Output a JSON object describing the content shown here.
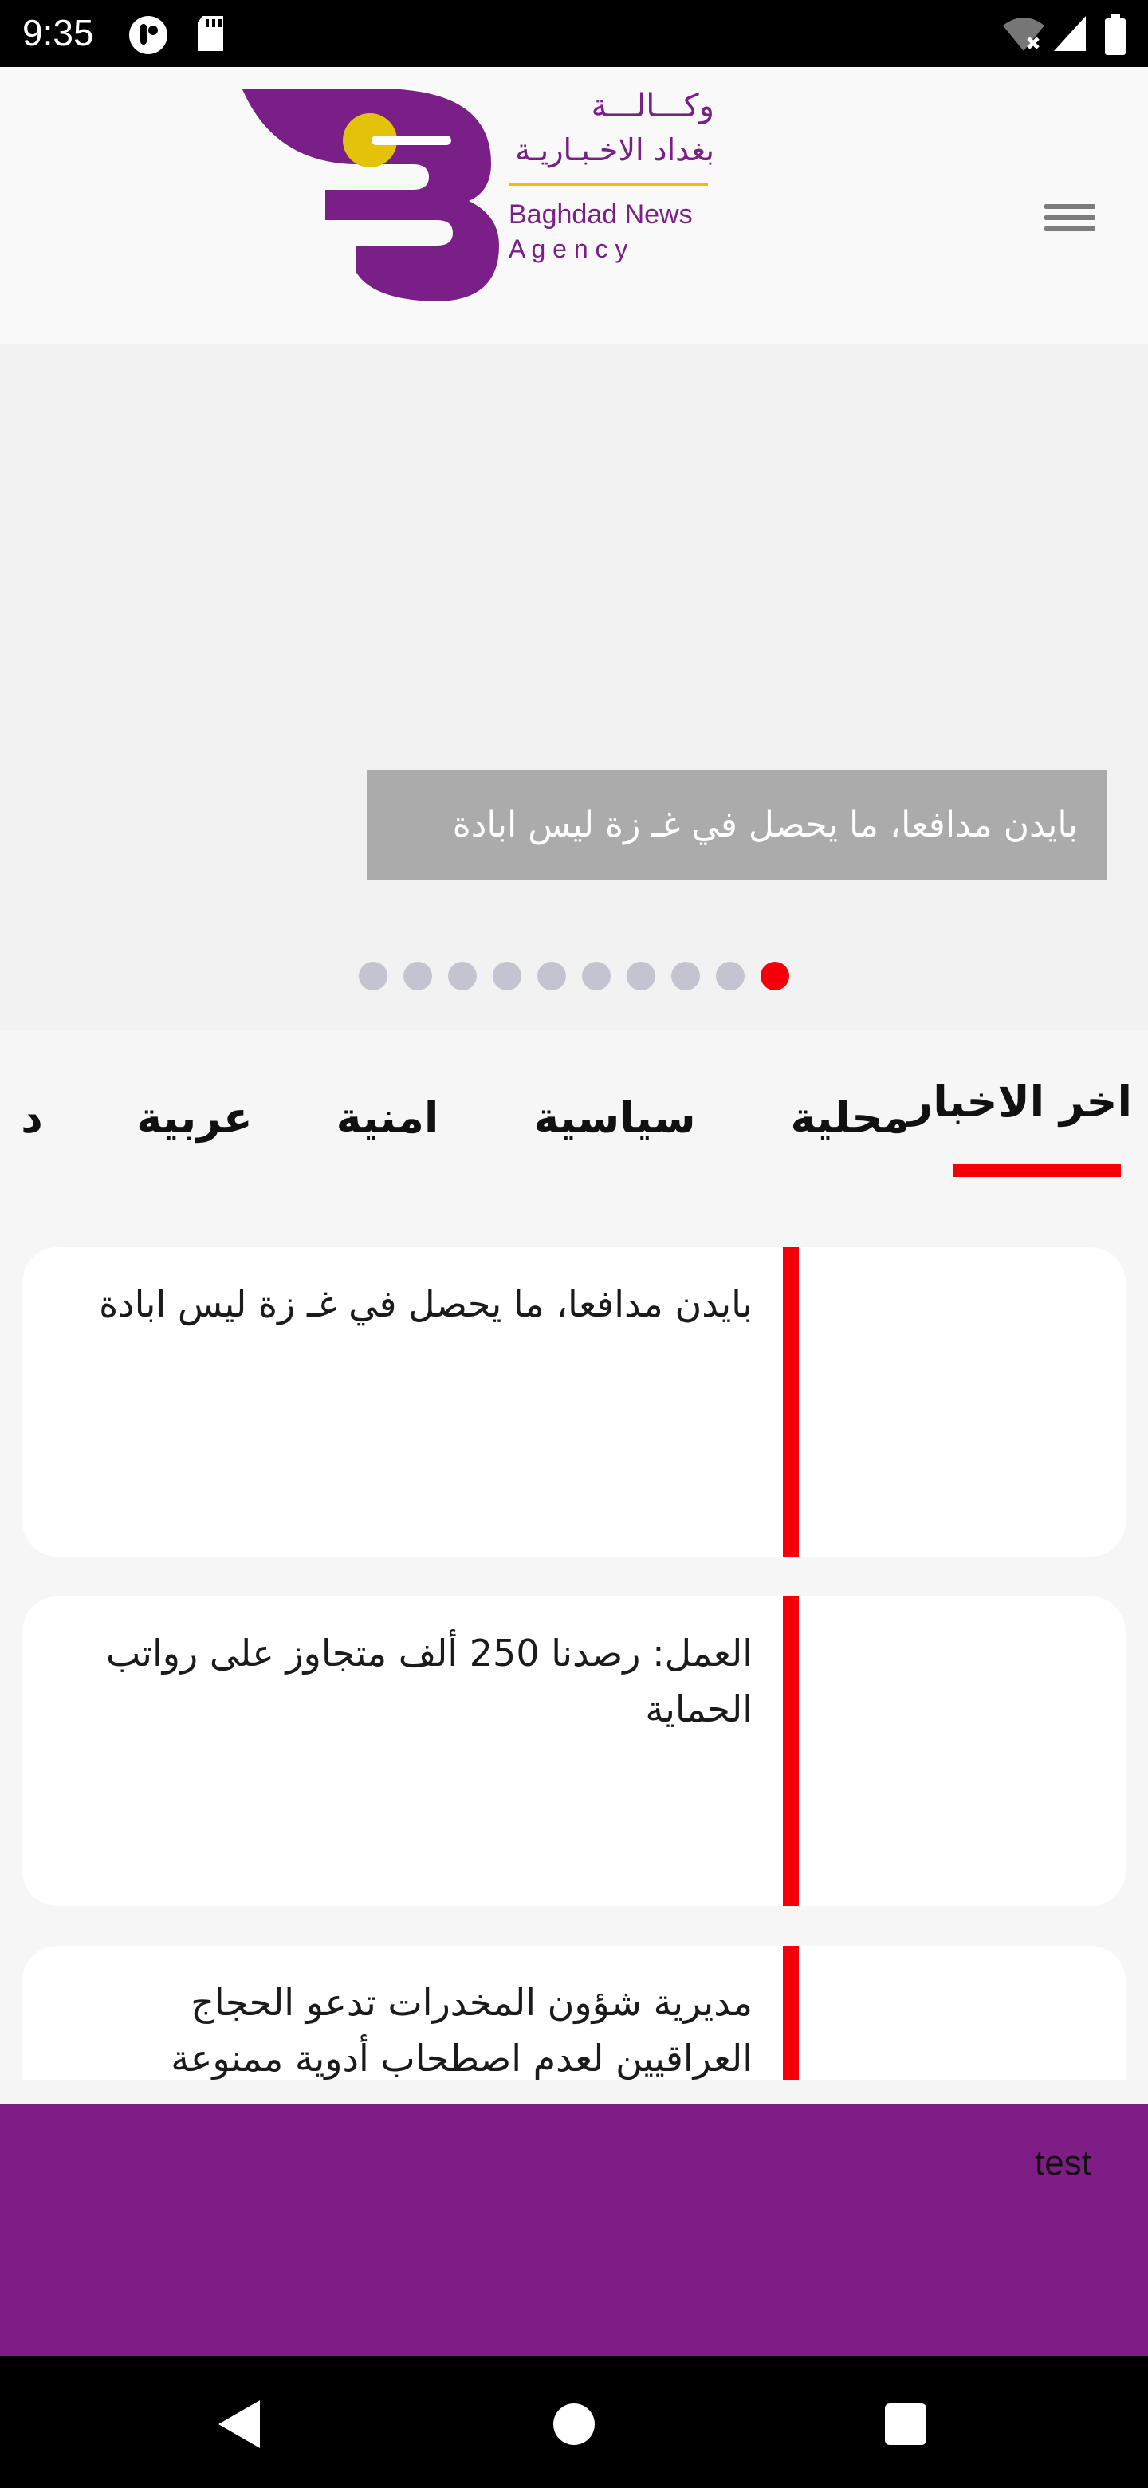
{
  "status_bar": {
    "time": "9:35",
    "left_icons": [
      "app-notification-icon",
      "sd-card-icon"
    ],
    "right_icons": [
      "wifi-off-icon",
      "cell-signal-icon",
      "battery-icon"
    ]
  },
  "header": {
    "logo_ar_line1": "وكـــالـــة",
    "logo_ar_line2": "بغداد الاخـبـاريـة",
    "logo_en_line1": "Baghdad News",
    "logo_en_line2": "A g e n c y",
    "menu_icon": "hamburger-menu-icon",
    "brand_purple": "#7a1f87",
    "brand_yellow": "#e2c30a"
  },
  "slider": {
    "caption": "بايدن مدافعا، ما يحصل في غـ زة ليس ابادة",
    "dot_count": 10,
    "active_dot_from_right": 1,
    "active_color": "#f3000b",
    "inactive_color": "#c3c4d0"
  },
  "tabs": {
    "items": [
      {
        "label": "اخر الاخبار",
        "active": true
      },
      {
        "label": "محلية",
        "active": false
      },
      {
        "label": "سياسية",
        "active": false
      },
      {
        "label": "امنية",
        "active": false
      },
      {
        "label": "عربية",
        "active": false
      },
      {
        "label": "د",
        "active": false
      }
    ]
  },
  "news": {
    "items": [
      {
        "title": "بايدن مدافعا، ما يحصل في غـ زة ليس ابادة"
      },
      {
        "title": "العمل: رصدنا 250 ألف متجاوز على رواتب الحماية"
      },
      {
        "title": "مديرية شؤون المخدرات تدعو الحجاج العراقيين لعدم اصطحاب أدوية ممنوعة"
      }
    ]
  },
  "footer": {
    "text": "test",
    "background": "#7f1d87"
  },
  "nav_bar": {
    "buttons": [
      "back-icon",
      "home-icon",
      "recents-icon"
    ]
  }
}
